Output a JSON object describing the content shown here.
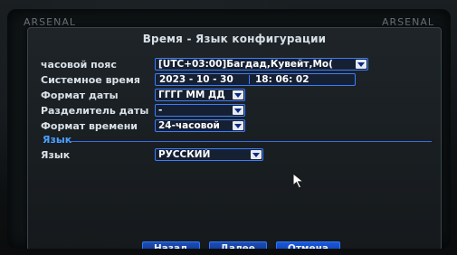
{
  "brand": {
    "left": "ARSENAL",
    "right": "ARSENAL"
  },
  "dialog": {
    "title": "Время - Язык конфигурации",
    "fields": {
      "timezone": {
        "label": "часовой пояс",
        "value": "[UTC+03:00]Багдад,Кувейт,Мо("
      },
      "system_time": {
        "label": "Системное время",
        "date": "2023 - 10 - 30",
        "time": "18: 06: 02"
      },
      "date_format": {
        "label": "Формат даты",
        "value": "ГГГГ ММ ДД"
      },
      "date_separator": {
        "label": "Разделитель даты",
        "value": "-"
      },
      "time_format": {
        "label": "Формат времени",
        "value": "24-часовой"
      }
    },
    "language_section": {
      "title": "Язык",
      "label": "Язык",
      "value": "РУССКИЙ"
    },
    "buttons": {
      "back": "Назад",
      "next": "Далее",
      "cancel": "Отмена"
    }
  },
  "icons": {
    "dropdown": "chevron-down-icon",
    "cursor": "mouse-pointer-icon"
  }
}
